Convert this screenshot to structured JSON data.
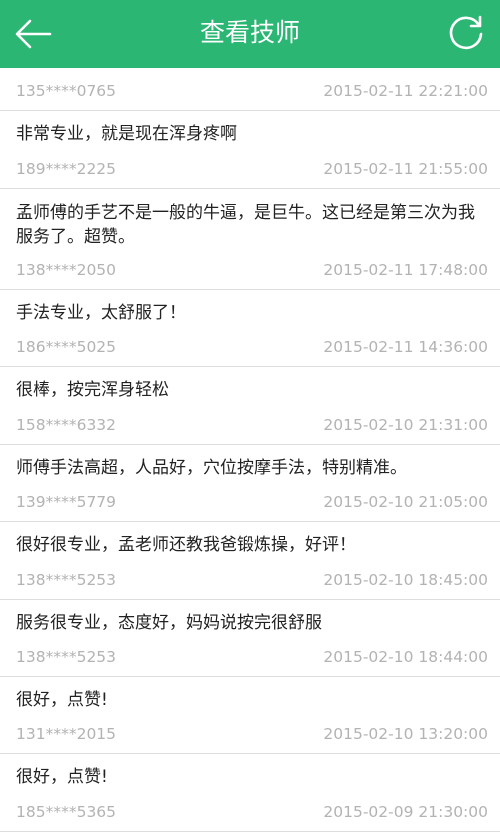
{
  "header": {
    "title": "查看技师",
    "back_icon": "back-arrow-icon",
    "refresh_icon": "refresh-icon",
    "bar_color": "#2bb673"
  },
  "reviews": [
    {
      "content": "",
      "phone": "135****0765",
      "time": "2015-02-11 22:21:00"
    },
    {
      "content": "非常专业，就是现在浑身疼啊",
      "phone": "189****2225",
      "time": "2015-02-11 21:55:00"
    },
    {
      "content": "孟师傅的手艺不是一般的牛逼，是巨牛。这已经是第三次为我服务了。超赞。",
      "phone": "138****2050",
      "time": "2015-02-11 17:48:00"
    },
    {
      "content": "手法专业，太舒服了！",
      "phone": "186****5025",
      "time": "2015-02-11 14:36:00"
    },
    {
      "content": "很棒，按完浑身轻松",
      "phone": "158****6332",
      "time": "2015-02-10 21:31:00"
    },
    {
      "content": "师傅手法高超，人品好，穴位按摩手法，特别精准。",
      "phone": "139****5779",
      "time": "2015-02-10 21:05:00"
    },
    {
      "content": "很好很专业，孟老师还教我爸锻炼操，好评！",
      "phone": "138****5253",
      "time": "2015-02-10 18:45:00"
    },
    {
      "content": "服务很专业，态度好，妈妈说按完很舒服",
      "phone": "138****5253",
      "time": "2015-02-10 18:44:00"
    },
    {
      "content": "很好，点赞!",
      "phone": "131****2015",
      "time": "2015-02-10 13:20:00"
    },
    {
      "content": "很好，点赞!",
      "phone": "185****5365",
      "time": "2015-02-09 21:30:00"
    }
  ]
}
